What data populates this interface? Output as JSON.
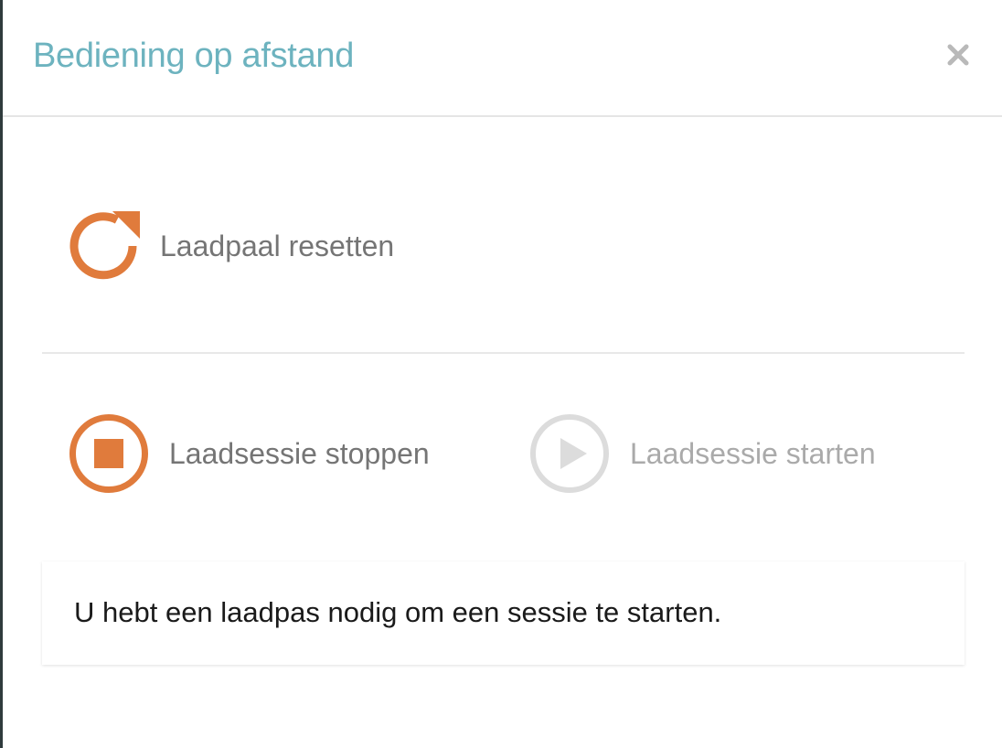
{
  "modal": {
    "title": "Bediening op afstand",
    "close_icon": "close-icon"
  },
  "actions": {
    "reset": {
      "label": "Laadpaal resetten",
      "icon": "refresh-icon",
      "enabled": true
    },
    "stop": {
      "label": "Laadsessie stoppen",
      "icon": "stop-icon",
      "enabled": true
    },
    "start": {
      "label": "Laadsessie starten",
      "icon": "play-icon",
      "enabled": false
    }
  },
  "notice": {
    "text": "U hebt een laadpas nodig om een sessie te starten."
  },
  "colors": {
    "title": "#6db3bf",
    "accent": "#e07b3c",
    "disabled": "#d8d8d8",
    "label": "#757575"
  }
}
